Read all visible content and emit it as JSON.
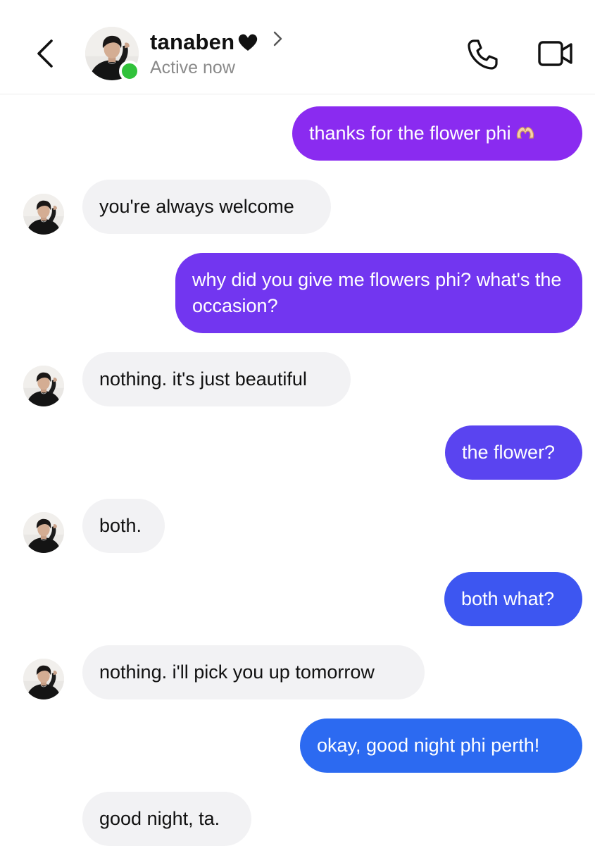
{
  "header": {
    "contact_name": "tanaben",
    "name_emoji": "black-heart-icon",
    "status": "Active now",
    "icons": {
      "back": "chevron-left-icon",
      "profile": "chevron-right-icon",
      "call": "phone-icon",
      "video": "video-camera-icon"
    },
    "online_color": "#31c23b"
  },
  "colors": {
    "incoming_bubble": "#f2f2f4",
    "outgoing_gradient_top": "#8a2bf0",
    "outgoing_gradient_bottom": "#2c6af1"
  },
  "messages": [
    {
      "direction": "out",
      "text": "thanks for the flower phi",
      "emoji": "heart-hands-icon"
    },
    {
      "direction": "in",
      "text": "you're always welcome"
    },
    {
      "direction": "out",
      "text": "why did you give me flowers phi? what's the occasion?"
    },
    {
      "direction": "in",
      "text": "nothing. it's just beautiful"
    },
    {
      "direction": "out",
      "text": "the flower?"
    },
    {
      "direction": "in",
      "text": "both."
    },
    {
      "direction": "out",
      "text": "both what?"
    },
    {
      "direction": "in",
      "text": "nothing. i'll pick you up tomorrow"
    },
    {
      "direction": "out",
      "text": "okay, good night phi perth!"
    },
    {
      "direction": "in",
      "text": "good night, ta."
    }
  ]
}
